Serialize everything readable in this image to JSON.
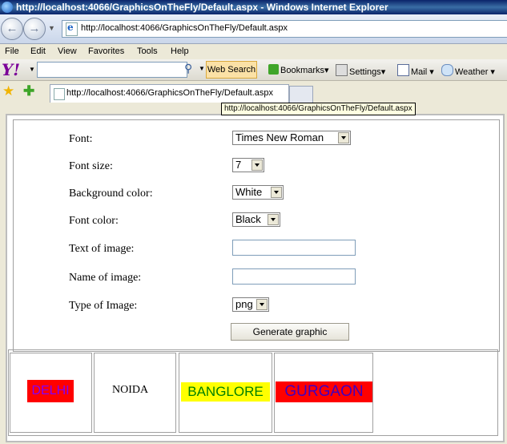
{
  "window": {
    "title": "http://localhost:4066/GraphicsOnTheFly/Default.aspx - Windows Internet Explorer"
  },
  "address": {
    "url": "http://localhost:4066/GraphicsOnTheFly/Default.aspx"
  },
  "menu": [
    "File",
    "Edit",
    "View",
    "Favorites",
    "Tools",
    "Help"
  ],
  "yahoo_toolbar": {
    "search_placeholder": "",
    "web_search_label": "Web Search",
    "bookmarks_label": "Bookmarks",
    "settings_label": "Settings",
    "mail_label": "Mail",
    "weather_label": "Weather"
  },
  "tab": {
    "label": "http://localhost:4066/GraphicsOnTheFly/Default.aspx"
  },
  "tooltip": "http://localhost:4066/GraphicsOnTheFly/Default.aspx",
  "form": {
    "font_label": "Font:",
    "font_value": "Times New Roman",
    "font_size_label": "Font size:",
    "font_size_value": "7",
    "bg_color_label": "Background color:",
    "bg_color_value": "White",
    "font_color_label": "Font color:",
    "font_color_value": "Black",
    "text_label": "Text of image:",
    "text_value": "",
    "name_label": "Name of image:",
    "name_value": "",
    "type_label": "Type of Image:",
    "type_value": "png",
    "generate_label": "Generate graphic"
  },
  "generated_images": [
    {
      "text": "DELHI",
      "background": "#ff0000",
      "color": "#8000ff"
    },
    {
      "text": "NOIDA",
      "background": "#ffffff",
      "color": "#000000"
    },
    {
      "text": "BANGLORE",
      "background": "#ffff00",
      "color": "#008000"
    },
    {
      "text": "GURGAON",
      "background": "#ff0000",
      "color": "#4000c0"
    }
  ]
}
